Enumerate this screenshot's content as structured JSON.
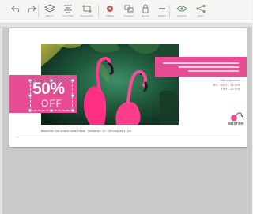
{
  "colors": {
    "accent_pink": "#e84d93",
    "toolbar_bg": "#f5f5f3",
    "workspace_bg": "#c9c9c9",
    "page_bg": "#ffffff"
  },
  "toolbar": {
    "items": [
      {
        "name": "undo-icon",
        "label": ""
      },
      {
        "name": "redo-icon",
        "label": ""
      },
      {
        "name": "layers-icon",
        "label": "Ebenen"
      },
      {
        "name": "align-icon",
        "label": "Ausrichten"
      },
      {
        "name": "crop-icon",
        "label": "Zuschneiden"
      },
      {
        "name": "effects-icon",
        "label": "Effekte"
      },
      {
        "name": "arrange-icon",
        "label": "Anordnen"
      },
      {
        "name": "lock-icon",
        "label": "Sperren"
      },
      {
        "name": "position-icon",
        "label": "Position"
      },
      {
        "name": "preview-icon",
        "label": "Vorschau"
      },
      {
        "name": "share-icon",
        "label": "Teilen"
      }
    ]
  },
  "canvas": {
    "sale": {
      "percent": "50%",
      "word": "OFF"
    },
    "info": {
      "title": "Öffnungszeiten",
      "line1": "MO – DO 9 – 18 UHR",
      "line2": "FR 9 – 20 UHR"
    },
    "logo": {
      "text": "MUSTER"
    },
    "footer": {
      "text": "Besuchen Sie unsere neue Filiale · Musterstr. 12 · Öffnung ab 1. Juli"
    }
  }
}
